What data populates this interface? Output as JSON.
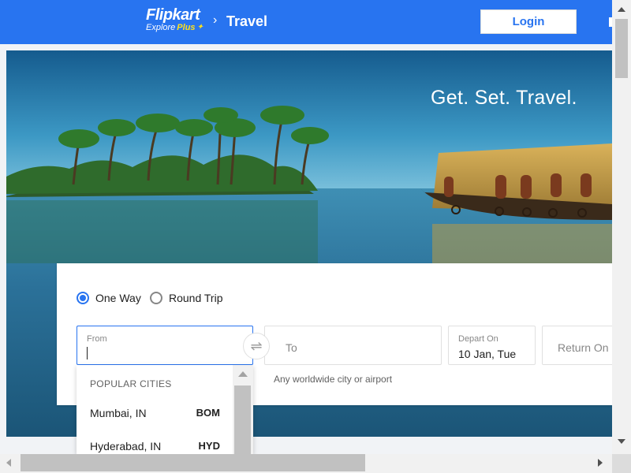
{
  "header": {
    "logo_main": "Flipkart",
    "logo_explore": "Explore",
    "logo_plus": "Plus",
    "breadcrumb_sep": "›",
    "section_title": "Travel",
    "login_label": "Login"
  },
  "hero": {
    "tagline": "Get. Set. Travel."
  },
  "search": {
    "trip_types": [
      {
        "label": "One Way",
        "selected": true
      },
      {
        "label": "Round Trip",
        "selected": false
      }
    ],
    "from": {
      "label": "From",
      "value": ""
    },
    "swap_icon": "swap-arrows-icon",
    "to": {
      "placeholder": "To"
    },
    "depart": {
      "label": "Depart On",
      "value": "10 Jan, Tue"
    },
    "return": {
      "placeholder": "Return On"
    },
    "to_hint": "Any worldwide city or airport"
  },
  "dropdown": {
    "heading": "POPULAR CITIES",
    "cities": [
      {
        "city": "Mumbai, IN",
        "code": "BOM"
      },
      {
        "city": "Hyderabad, IN",
        "code": "HYD"
      }
    ]
  },
  "colors": {
    "brand": "#2874f0",
    "accent_yellow": "#ffe11b"
  }
}
